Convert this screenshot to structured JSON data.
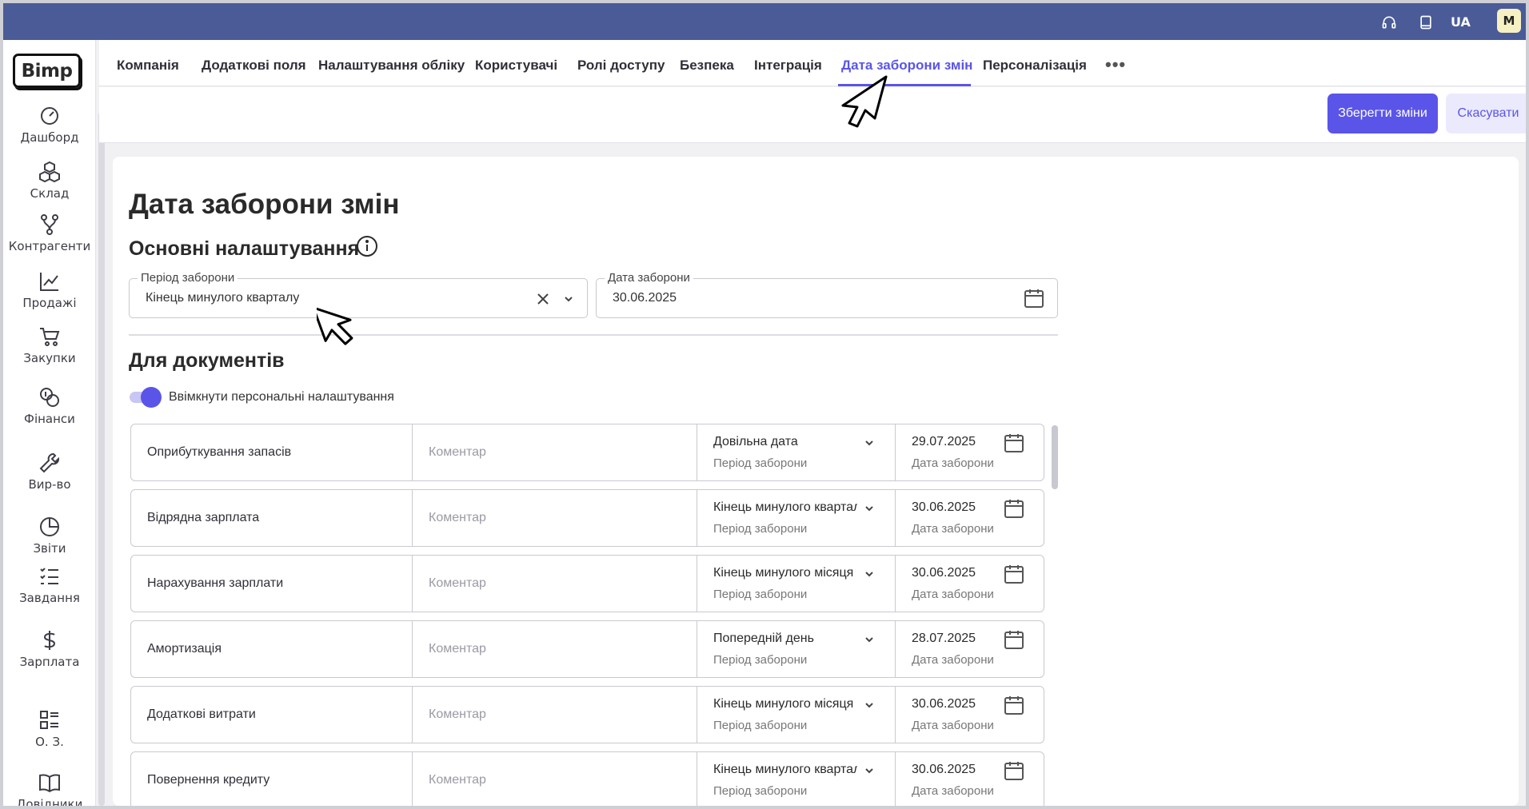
{
  "topbar": {
    "lang": "UA",
    "avatar_initial": "M",
    "icons": [
      "headset-icon",
      "book-icon"
    ]
  },
  "sidebar": {
    "logo": "Bimp",
    "items": [
      {
        "label": "Дашборд",
        "icon": "gauge-icon"
      },
      {
        "label": "Склад",
        "icon": "boxes-icon"
      },
      {
        "label": "Контрагенти",
        "icon": "branch-icon"
      },
      {
        "label": "Продажі",
        "icon": "chart-line-icon"
      },
      {
        "label": "Закупки",
        "icon": "cart-icon"
      },
      {
        "label": "Фінанси",
        "icon": "coins-icon"
      },
      {
        "label": "Вир-во",
        "icon": "wrench-icon"
      },
      {
        "label": "Звіти",
        "icon": "pie-icon"
      },
      {
        "label": "Завдання",
        "icon": "checklist-icon"
      },
      {
        "label": "Зарплата",
        "icon": "dollar-icon"
      },
      {
        "label": "О. З.",
        "icon": "grid-list-icon"
      },
      {
        "label": "Довідники",
        "icon": "open-book-icon"
      }
    ]
  },
  "nav": {
    "tabs": [
      {
        "label": "Компанія"
      },
      {
        "label": "Додаткові поля"
      },
      {
        "label": "Налаштування обліку"
      },
      {
        "label": "Користувачі"
      },
      {
        "label": "Ролі доступу"
      },
      {
        "label": "Безпека"
      },
      {
        "label": "Інтеграція"
      },
      {
        "label": "Дата заборони змін",
        "active": true
      },
      {
        "label": "Персоналізація"
      }
    ],
    "more": "•••"
  },
  "actions": {
    "save_label": "Зберегти зміни",
    "cancel_label": "Скасувати"
  },
  "main": {
    "title": "Дата заборони змін",
    "basic_heading": "Основні налаштування",
    "period_field": {
      "label": "Період заборони",
      "value": "Кінець минулого кварталу"
    },
    "date_field": {
      "label": "Дата заборони",
      "value": "30.06.2025"
    },
    "docs_heading": "Для документів",
    "toggle_label": "Ввімкнути персональні налаштування",
    "toggle_on": true,
    "comment_placeholder": "Коментар",
    "period_sublabel": "Період заборони",
    "date_sublabel": "Дата заборони",
    "rows": [
      {
        "name": "Оприбуткування запасів",
        "period": "Довільна дата",
        "date": "29.07.2025"
      },
      {
        "name": "Відрядна зарплата",
        "period": "Кінець минулого кварталу",
        "date": "30.06.2025"
      },
      {
        "name": "Нарахування зарплати",
        "period": "Кінець минулого місяця",
        "date": "30.06.2025"
      },
      {
        "name": "Амортизація",
        "period": "Попередній день",
        "date": "28.07.2025"
      },
      {
        "name": "Додаткові витрати",
        "period": "Кінець минулого місяця",
        "date": "30.06.2025"
      },
      {
        "name": "Повернення кредиту",
        "period": "Кінець минулого кварталу",
        "date": "30.06.2025"
      }
    ]
  },
  "colors": {
    "topbar": "#4a5b98",
    "accent": "#5a55e8"
  }
}
